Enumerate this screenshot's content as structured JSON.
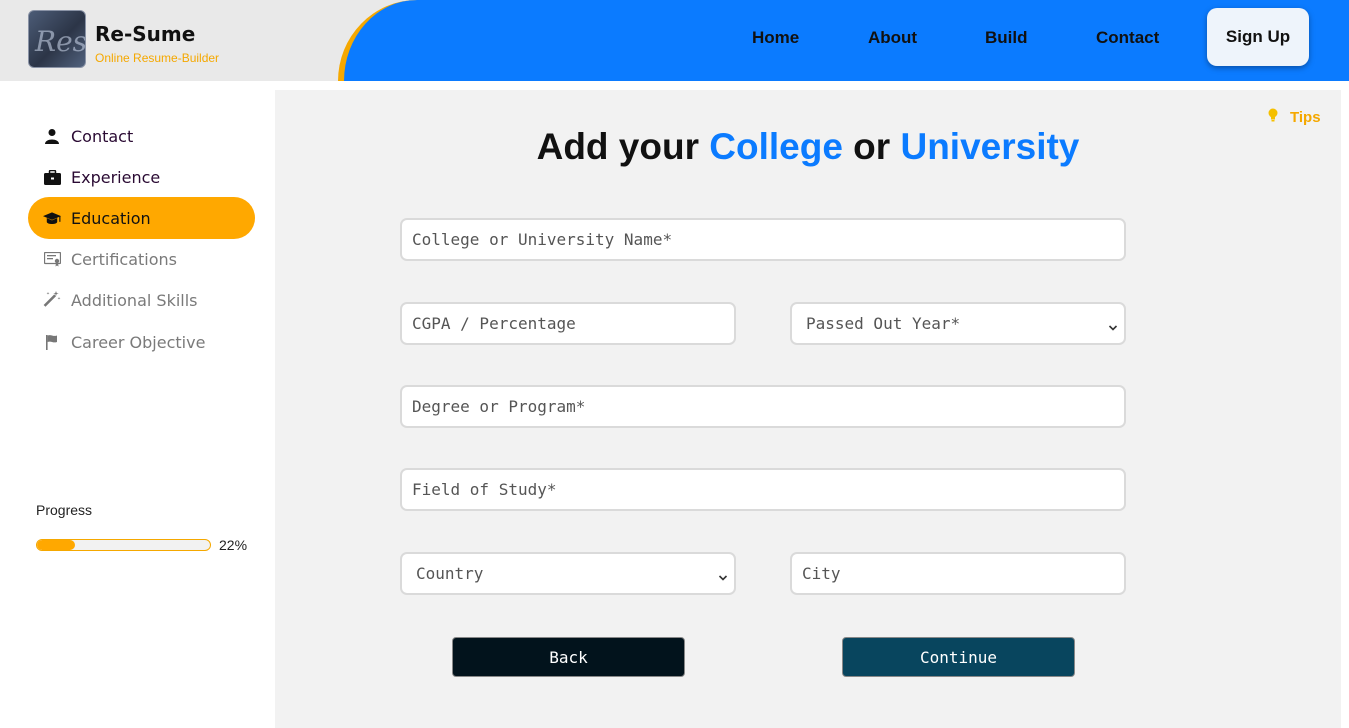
{
  "brand": {
    "logo_text": "Res",
    "name": "Re-Sume",
    "tagline": "Online Resume-Builder"
  },
  "nav": {
    "items": [
      "Home",
      "About",
      "Build",
      "Contact"
    ],
    "signup_label": "Sign Up"
  },
  "sidebar": {
    "items": [
      {
        "label": "Contact",
        "icon": "user-icon",
        "state": "done"
      },
      {
        "label": "Experience",
        "icon": "briefcase-icon",
        "state": "done"
      },
      {
        "label": "Education",
        "icon": "graduation-cap-icon",
        "state": "active"
      },
      {
        "label": "Certifications",
        "icon": "certificate-icon",
        "state": "todo"
      },
      {
        "label": "Additional Skills",
        "icon": "magic-wand-icon",
        "state": "todo"
      },
      {
        "label": "Career Objective",
        "icon": "flag-icon",
        "state": "todo"
      }
    ],
    "progress": {
      "label": "Progress",
      "percent": 22,
      "percent_text": "22%"
    }
  },
  "tips_label": "Tips",
  "heading": {
    "part1": "Add your ",
    "highlight1": "College",
    "part2": " or ",
    "highlight2": "University"
  },
  "form": {
    "college_placeholder": "College or University Name*",
    "cgpa_placeholder": "CGPA / Percentage",
    "passed_year_selected": "Passed Out Year*",
    "degree_placeholder": "Degree or Program*",
    "field_placeholder": "Field of Study*",
    "country_selected": "Country",
    "city_placeholder": "City"
  },
  "buttons": {
    "back": "Back",
    "continue": "Continue"
  },
  "colors": {
    "header_blue": "#0b7bff",
    "accent_orange": "#ffa800",
    "back_button": "#02131c",
    "continue_button": "#08455e"
  }
}
